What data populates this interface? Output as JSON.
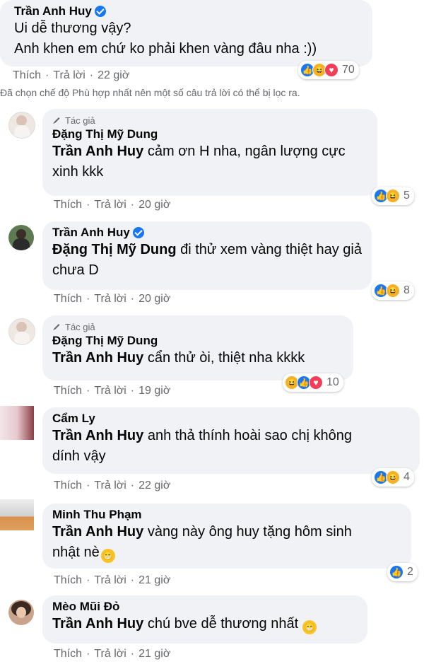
{
  "top_comment": {
    "author": "Trần Anh Huy",
    "lines": [
      "Ui dễ thương vậy?",
      "Anh khen em chứ ko phải khen vàng đâu nha :))"
    ],
    "like": "Thích",
    "reply": "Trả lời",
    "time": "22 giờ",
    "reaction_count": "70"
  },
  "filter_notice": "Đã chọn chế độ Phù hợp nhất nên một số câu trả lời có thể bị lọc ra.",
  "replies": [
    {
      "author_tag": "Tác giả",
      "author": "Đặng Thị Mỹ Dung",
      "mention": "Trần Anh Huy",
      "text": "cảm ơn H nha, ngân lượng cực xinh kkk",
      "line1": " cảm ơn H nha, ngân lượng cực",
      "line2": "xinh kkk",
      "like": "Thích",
      "reply": "Trả lời",
      "time": "20 giờ",
      "reaction_count": "5"
    },
    {
      "author": "Trần Anh Huy",
      "mention": "Đặng Thị Mỹ Dung",
      "line1": " đi thử xem vàng thiệt hay giả",
      "line2": "chưa D",
      "like": "Thích",
      "reply": "Trả lời",
      "time": "20 giờ",
      "reaction_count": "8"
    },
    {
      "author_tag": "Tác giả",
      "author": "Đặng Thị Mỹ Dung",
      "mention": "Trần Anh Huy",
      "line1": " cẩn thử òi, thiệt nha kkkk",
      "like": "Thích",
      "reply": "Trả lời",
      "time": "19 giờ",
      "reaction_count": "10"
    },
    {
      "author": "Cẩm Ly",
      "mention": "Trần Anh Huy",
      "line1": " anh thả thính hoài sao chị không",
      "line2": "dính vậy",
      "like": "Thích",
      "reply": "Trả lời",
      "time": "22 giờ",
      "reaction_count": "4"
    },
    {
      "author": "Minh Thu Phạm",
      "mention": "Trần Anh Huy",
      "line1": " vàng này ông huy tặng hôm sinh",
      "line2": "nhật nè",
      "like": "Thích",
      "reply": "Trả lời",
      "time": "21 giờ",
      "reaction_count": "2"
    },
    {
      "author": "Mèo Mũi Đỏ",
      "mention": "Trần Anh Huy",
      "line1": " chú bve dễ thương nhất",
      "like": "Thích",
      "reply": "Trả lời",
      "time": "21 giờ"
    }
  ],
  "colors": {
    "like": "#1877f2",
    "haha": "#f7b125",
    "love": "#f33e58",
    "bubble": "#f0f2f5",
    "meta": "#65676b"
  },
  "icons": {
    "like": "like-icon",
    "haha": "haha-icon",
    "love": "love-icon",
    "verified": "verified-badge-icon",
    "author_tag": "pen-icon",
    "emoji": "grin-emoji-icon"
  }
}
